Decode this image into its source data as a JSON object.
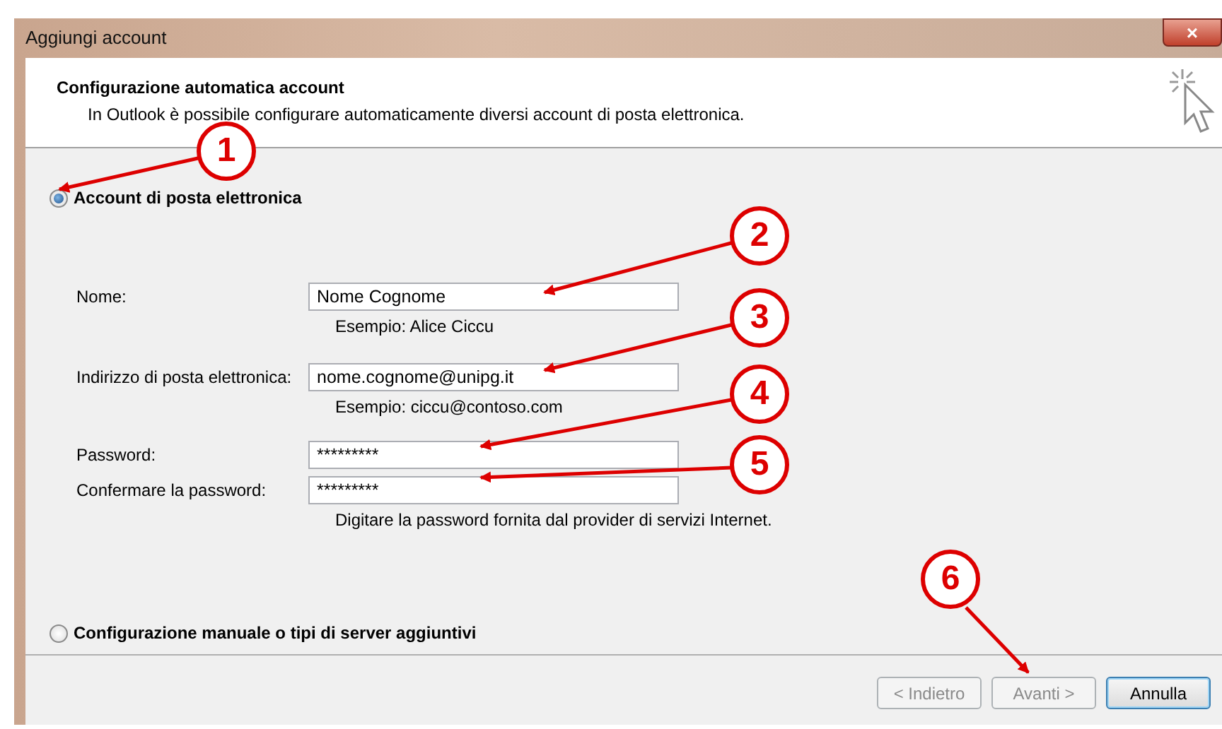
{
  "window": {
    "title": "Aggiungi account",
    "close": "×"
  },
  "header": {
    "title": "Configurazione automatica account",
    "subtitle": "In Outlook è possibile configurare automaticamente diversi account di posta elettronica."
  },
  "options": [
    {
      "label": "Account di posta elettronica",
      "selected": true
    },
    {
      "label": "Configurazione manuale o tipi di server aggiuntivi",
      "selected": false
    }
  ],
  "fields": [
    {
      "label": "Nome:",
      "value": "Nome Cognome",
      "hint": "Esempio: Alice Ciccu"
    },
    {
      "label": "Indirizzo di posta elettronica:",
      "value": "nome.cognome@unipg.it",
      "hint": "Esempio: ciccu@contoso.com"
    },
    {
      "label": "Password:",
      "value": "*********"
    },
    {
      "label": "Confermare la password:",
      "value": "*********",
      "hint": "Digitare la password fornita dal provider di servizi Internet."
    }
  ],
  "buttons": [
    {
      "label": "< Indietro",
      "disabled": true,
      "default": false
    },
    {
      "label": "Avanti >",
      "disabled": true,
      "default": false
    },
    {
      "label": "Annulla",
      "disabled": false,
      "default": true
    }
  ],
  "callouts": [
    {
      "label": "1"
    },
    {
      "label": "2"
    },
    {
      "label": "3"
    },
    {
      "label": "4"
    },
    {
      "label": "5"
    },
    {
      "label": "6"
    }
  ]
}
